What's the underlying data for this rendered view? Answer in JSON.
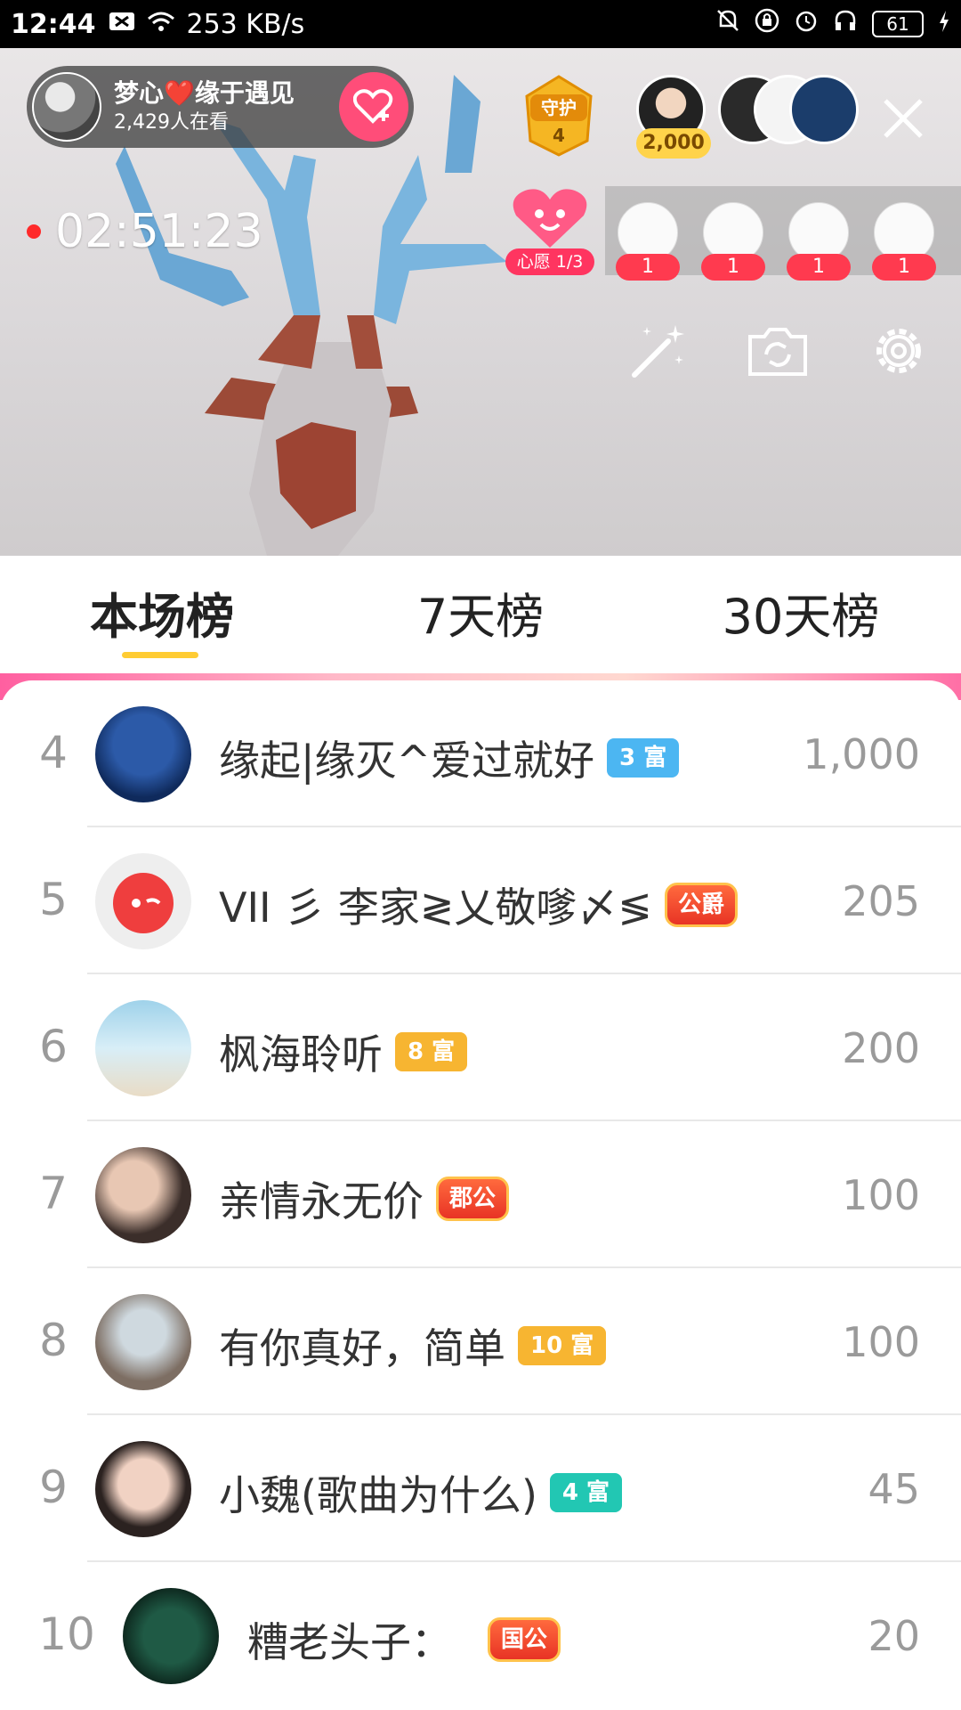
{
  "status_bar": {
    "time": "12:44",
    "speed": "253 KB/s",
    "battery": "61"
  },
  "live": {
    "host_name": "梦心❤️缘于遇见",
    "watching": "2,429人在看",
    "guard_label": "守护",
    "guard_count": "4",
    "top_fan_score": "2,000",
    "elapsed": "02:51:23",
    "wish_label": "心愿 1/3",
    "wish_counts": [
      "1",
      "1",
      "1",
      "1"
    ]
  },
  "tabs": [
    {
      "label": "本场榜",
      "active": true
    },
    {
      "label": "7天榜",
      "active": false
    },
    {
      "label": "30天榜",
      "active": false
    }
  ],
  "ranking": [
    {
      "rank": "4",
      "name": "缘起|缘灭^爱过就好",
      "badge": "3 富",
      "badge_type": "rich3",
      "score": "1,000"
    },
    {
      "rank": "5",
      "name": "VII 彡 李家≷乂敬嗲〆≶",
      "badge": "公爵",
      "badge_type": "noble",
      "score": "205"
    },
    {
      "rank": "6",
      "name": "枫海聆听",
      "badge": "8 富",
      "badge_type": "rich8",
      "score": "200"
    },
    {
      "rank": "7",
      "name": "亲情永无价",
      "badge": "郡公",
      "badge_type": "noble",
      "score": "100"
    },
    {
      "rank": "8",
      "name": "有你真好，简单",
      "badge": "10 富",
      "badge_type": "rich10",
      "score": "100"
    },
    {
      "rank": "9",
      "name": "小魏(歌曲为什么)",
      "badge": "4 富",
      "badge_type": "rich4",
      "score": "45"
    },
    {
      "rank": "10",
      "name": "糟老头子：",
      "badge": "国公",
      "badge_type": "noble",
      "score": "20"
    }
  ],
  "colors": {
    "accent_yellow": "#ffcc33",
    "follow_pink": "#ff4d79",
    "rec_red": "#ff2a2a"
  }
}
